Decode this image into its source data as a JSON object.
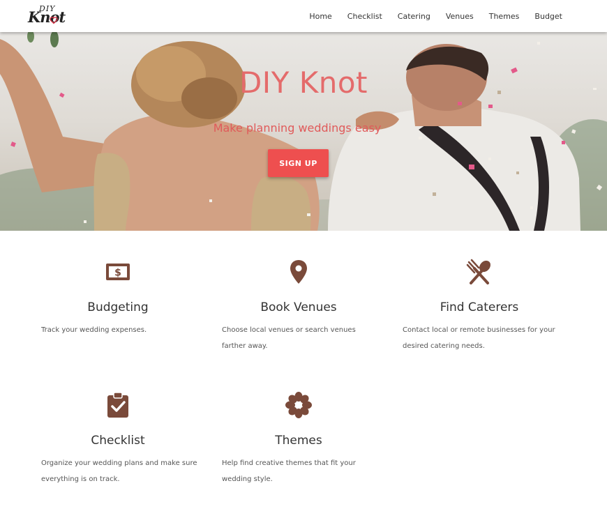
{
  "nav": {
    "logo_top": "DIY",
    "logo_main": "Knot",
    "links": [
      "Home",
      "Checklist",
      "Catering",
      "Venues",
      "Themes",
      "Budget"
    ]
  },
  "hero": {
    "title": "DIY Knot",
    "subtitle": "Make planning weddings easy",
    "cta_label": "SIGN UP"
  },
  "features": [
    {
      "icon": "dollar-sign-icon",
      "title": "Budgeting",
      "description": "Track your wedding expenses."
    },
    {
      "icon": "map-pin-icon",
      "title": "Book Venues",
      "description": "Choose local venues or search venues farther away."
    },
    {
      "icon": "utensils-icon",
      "title": "Find Caterers",
      "description": "Contact local or remote businesses for your desired catering needs."
    },
    {
      "icon": "clipboard-check-icon",
      "title": "Checklist",
      "description": "Organize your wedding plans and make sure everything is on track."
    },
    {
      "icon": "flower-icon",
      "title": "Themes",
      "description": "Help find creative themes that fit your wedding style."
    }
  ],
  "colors": {
    "accent": "#ee4f4f",
    "hero_title": "#e46b6b",
    "icon": "#7a4a3a"
  }
}
